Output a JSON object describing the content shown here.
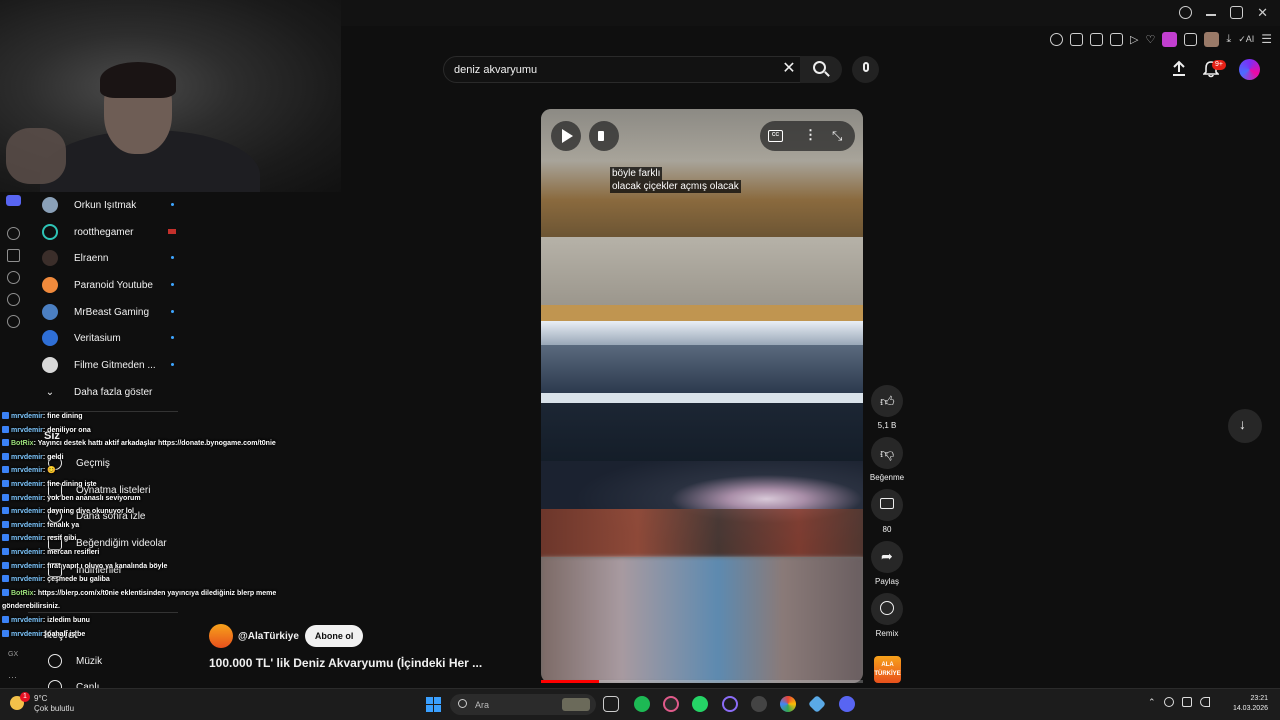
{
  "search": {
    "query": "deniz akvaryumu"
  },
  "header": {
    "notification_count": "9+"
  },
  "sidebar": {
    "subscriptions": [
      {
        "name": "Orkun Işıtmak",
        "live": false
      },
      {
        "name": "rootthegamer",
        "live": true
      },
      {
        "name": "Elraenn",
        "live": false
      },
      {
        "name": "Paranoid Youtube",
        "live": false
      },
      {
        "name": "MrBeast Gaming",
        "live": false
      },
      {
        "name": "Veritasium",
        "live": false
      },
      {
        "name": "Filme Gitmeden ...",
        "live": false
      }
    ],
    "show_more": "Daha fazla göster",
    "you_section_title": "Siz",
    "you_items": [
      "Geçmiş",
      "Oynatma listeleri",
      "Daha sonra izle",
      "Beğendiğim videolar",
      "İndirilenler"
    ],
    "explore_title": "Keşfet",
    "explore_items": [
      "Müzik",
      "Canlı"
    ]
  },
  "chat": [
    {
      "user": "mrvdemir",
      "text": ": fine dining",
      "bot": false
    },
    {
      "user": "mrvdemir",
      "text": ": deniliyor ona",
      "bot": false
    },
    {
      "user": "BotRix",
      "text": ": Yayıncı destek hattı aktif arkadaşlar https://donate.bynogame.com/t0nie",
      "bot": true
    },
    {
      "user": "mrvdemir",
      "text": ": geldi",
      "bot": false
    },
    {
      "user": "mrvdemir",
      "text": ": 😊",
      "bot": false
    },
    {
      "user": "mrvdemir",
      "text": ": fine dining işte",
      "bot": false
    },
    {
      "user": "mrvdemir",
      "text": ": yok ben ananaslı seviyorum",
      "bot": false
    },
    {
      "user": "mrvdemir",
      "text": ": dayning diye okunuyor lol",
      "bot": false
    },
    {
      "user": "mrvdemir",
      "text": ": fenalık ya",
      "bot": false
    },
    {
      "user": "mrvdemir",
      "text": ": resif gibi",
      "bot": false
    },
    {
      "user": "mrvdemir",
      "text": ": mercan resifleri",
      "bot": false
    },
    {
      "user": "mrvdemir",
      "text": ": fırat yapıt ı oluyo ya kanalında böyle",
      "bot": false
    },
    {
      "user": "mrvdemir",
      "text": ": çeşmede bu galiba",
      "bot": false
    },
    {
      "user": "BotRix",
      "text": ": https://blerp.com/x/t0nie eklentisinden yayıncıya dilediğiniz blerp meme",
      "bot": true
    },
    {
      "user": "",
      "text": "gönderebilirsiniz.",
      "bot": false
    },
    {
      "user": "mrvdemir",
      "text": ": izledim bunu",
      "bot": false
    },
    {
      "user": "mrvdemir",
      "text": ": pahalı iş be",
      "bot": false
    }
  ],
  "player": {
    "caption_lines": [
      "böyle farklı",
      "olacak çiçekler açmış olacak"
    ],
    "cc_label": "CC",
    "progress": 0.18
  },
  "actions": {
    "like_count": "5,1 B",
    "dislike_label": "Beğenme",
    "comments_count": "80",
    "share_label": "Paylaş",
    "remix_label": "Remix"
  },
  "video": {
    "channel": "@AlaTürkiye",
    "subscribe_label": "Abone ol",
    "title": "100.000 TL' lik Deniz Akvaryumu (İçindeki Her ...",
    "channel_thumb_text": "ALA TÜRKİYE"
  },
  "taskbar": {
    "weather_temp": "9°C",
    "weather_desc": "Çok bulutlu",
    "weather_badge": "1",
    "search_placeholder": "Ara",
    "time": "23:21",
    "date": "14.03.2026"
  },
  "left_misc": {
    "gx_label": "GX"
  }
}
